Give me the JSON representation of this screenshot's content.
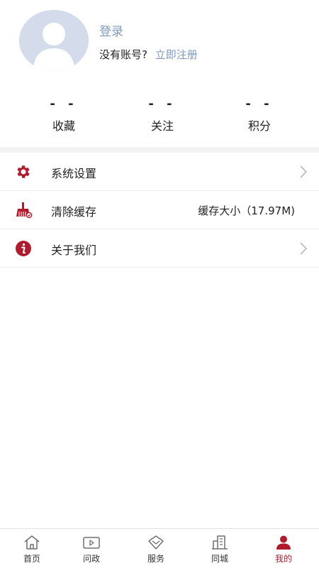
{
  "profile": {
    "login_label": "登录",
    "no_account_text": "没有账号?",
    "register_label": "立即注册"
  },
  "stats": [
    {
      "value": "- -",
      "label": "收藏"
    },
    {
      "value": "- -",
      "label": "关注"
    },
    {
      "value": "- -",
      "label": "积分"
    }
  ],
  "menu": {
    "items": [
      {
        "label": "系统设置",
        "icon": "gear-icon"
      },
      {
        "label": "清除缓存",
        "icon": "broom-icon",
        "value": "缓存大小（17.97M)"
      },
      {
        "label": "关于我们",
        "icon": "info-icon"
      }
    ]
  },
  "tabbar": {
    "items": [
      {
        "label": "首页",
        "icon": "home-icon"
      },
      {
        "label": "问政",
        "icon": "video-icon"
      },
      {
        "label": "服务",
        "icon": "service-icon"
      },
      {
        "label": "同城",
        "icon": "city-icon"
      },
      {
        "label": "我的",
        "icon": "user-icon",
        "active": true
      }
    ]
  },
  "colors": {
    "accent": "#b01c2e",
    "link": "#7f99bd",
    "avatar_bg": "#d4dcec"
  }
}
